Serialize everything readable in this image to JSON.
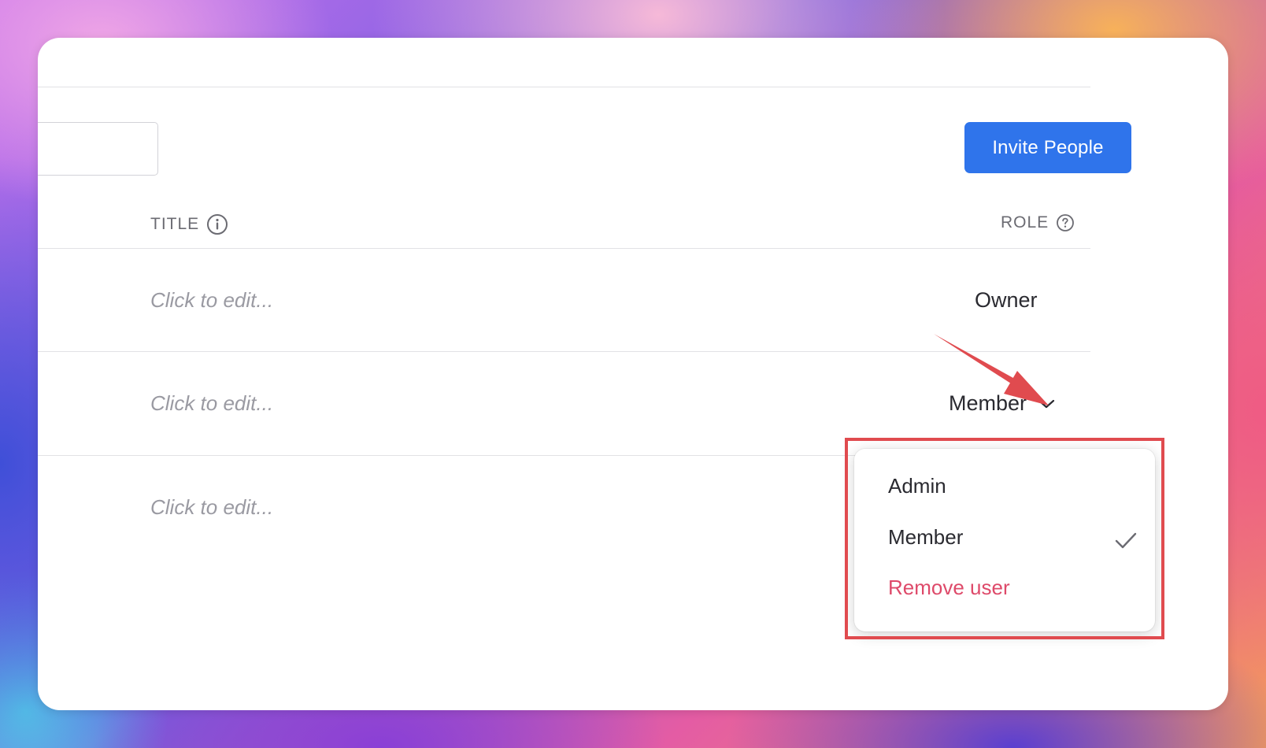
{
  "toolbar": {
    "invite_label": "Invite People"
  },
  "table": {
    "columns": [
      {
        "label": "TITLE",
        "icon": "info-icon"
      },
      {
        "label": "ROLE",
        "icon": "help-icon"
      }
    ],
    "rows": [
      {
        "title_placeholder": "Click to edit...",
        "role": "Owner"
      },
      {
        "title_placeholder": "Click to edit...",
        "role": "Member"
      },
      {
        "title_placeholder": "Click to edit..."
      }
    ]
  },
  "role_menu": {
    "items": [
      {
        "label": "Admin",
        "selected": false
      },
      {
        "label": "Member",
        "selected": true
      },
      {
        "label": "Remove user",
        "danger": true
      }
    ]
  },
  "colors": {
    "primary": "#2f74eb",
    "danger": "#de4a6a",
    "annotation": "#e04b4f"
  }
}
